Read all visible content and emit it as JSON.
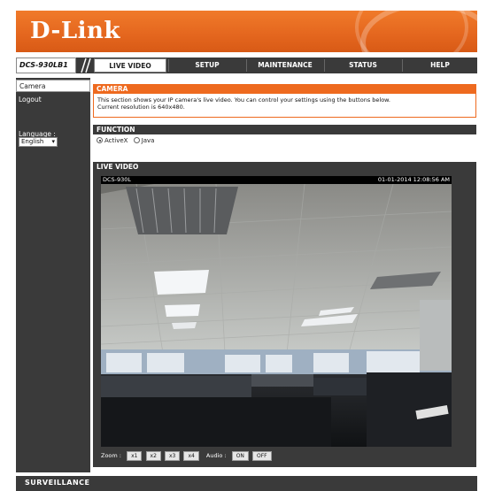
{
  "brand": {
    "logo": "D-Link"
  },
  "nav": {
    "model": "DCS-930LB1",
    "tabs": [
      {
        "label": "LIVE VIDEO",
        "active": true
      },
      {
        "label": "SETUP",
        "active": false
      },
      {
        "label": "MAINTENANCE",
        "active": false
      },
      {
        "label": "STATUS",
        "active": false
      },
      {
        "label": "HELP",
        "active": false
      }
    ]
  },
  "sidebar": {
    "items": [
      {
        "label": "Camera",
        "active": true
      },
      {
        "label": "Logout",
        "active": false
      }
    ],
    "language_label": "Language :",
    "language_value": "English"
  },
  "camera_section": {
    "title": "CAMERA",
    "description": "This section shows your IP camera's live video. You can control your settings using the buttons below.",
    "resolution": "Current resolution is 640x480."
  },
  "function_section": {
    "title": "FUNCTION",
    "options": [
      {
        "label": "ActiveX",
        "selected": true
      },
      {
        "label": "Java",
        "selected": false
      }
    ]
  },
  "live_video": {
    "title": "LIVE VIDEO",
    "camera_name": "DCS-930L",
    "timestamp": "01-01-2014 12:08:56 AM",
    "zoom_label": "Zoom :",
    "zoom_buttons": [
      "x1",
      "x2",
      "x3",
      "x4"
    ],
    "audio_label": "Audio :",
    "audio_buttons": [
      "ON",
      "OFF"
    ]
  },
  "footer": {
    "text": "SURVEILLANCE"
  },
  "colors": {
    "accent": "#ee6a1f",
    "dark": "#3a3a3a"
  }
}
